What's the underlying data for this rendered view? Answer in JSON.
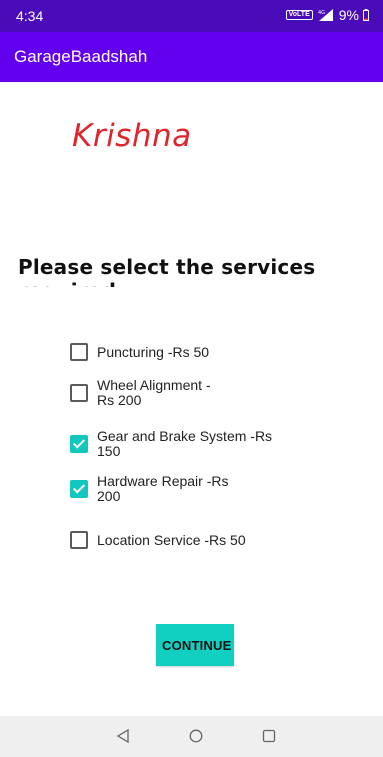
{
  "status_bar": {
    "time": "4:34",
    "volte_label": "VoLTE",
    "battery_percent": "9%",
    "icons": [
      "volte-icon",
      "signal-icon",
      "battery-icon"
    ]
  },
  "app_bar": {
    "title": "GarageBaadshah",
    "background": "#6200ee"
  },
  "garage_name": "Krishna",
  "prompt": "Please select the services required",
  "services": [
    {
      "label": "Puncturing  -Rs 50",
      "checked": false
    },
    {
      "label": "Wheel Alignment -Rs 200",
      "checked": false
    },
    {
      "label": "Gear and Brake System -Rs 150",
      "checked": true
    },
    {
      "label": "Hardware Repair  -Rs 200",
      "checked": true
    },
    {
      "label": "Location Service  -Rs 50",
      "checked": false
    }
  ],
  "continue_label": "CONTINUE",
  "accent_color": "#12c7bd",
  "nav_bar": {
    "icons": [
      "back-icon",
      "home-icon",
      "recents-icon"
    ]
  }
}
